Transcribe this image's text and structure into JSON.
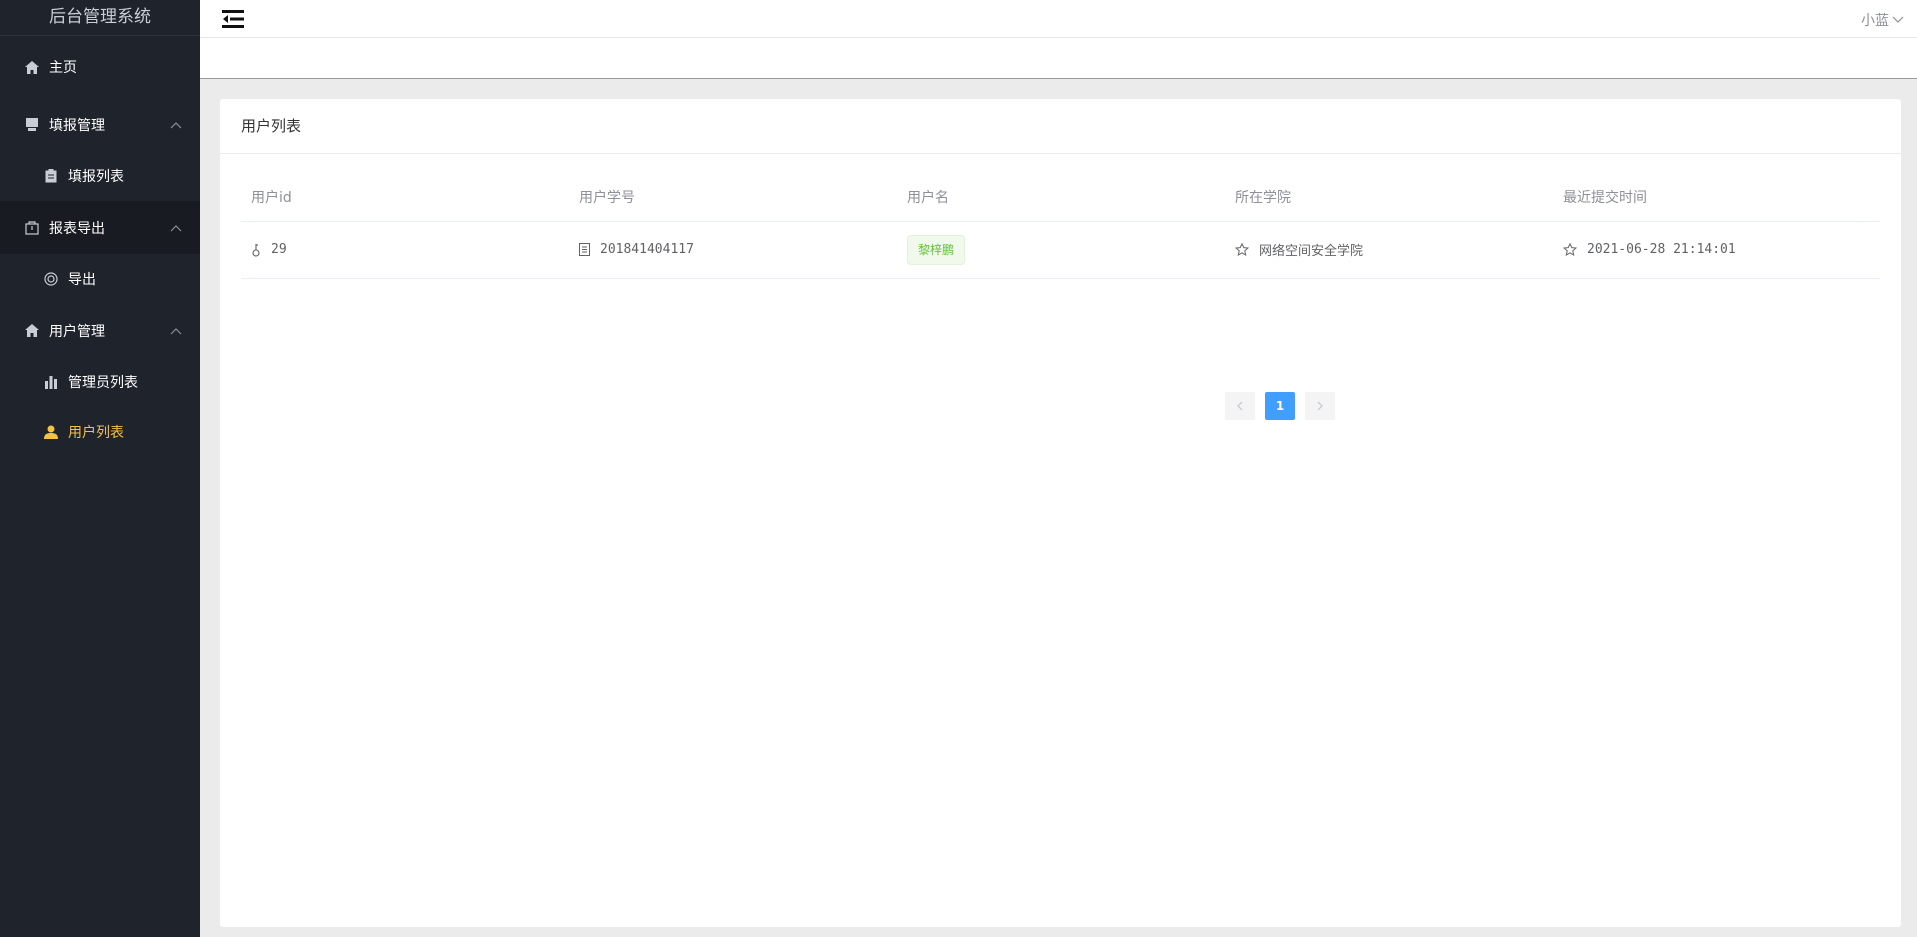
{
  "sidebar": {
    "brand": "后台管理系统",
    "items": [
      {
        "label": "主页"
      },
      {
        "label": "填报管理"
      },
      {
        "label": "填报列表"
      },
      {
        "label": "报表导出"
      },
      {
        "label": "导出"
      },
      {
        "label": "用户管理"
      },
      {
        "label": "管理员列表"
      },
      {
        "label": "用户列表"
      }
    ]
  },
  "topbar": {
    "user_name": "小蓝"
  },
  "card": {
    "title": "用户列表"
  },
  "table": {
    "headers": [
      "用户id",
      "用户学号",
      "用户名",
      "所在学院",
      "最近提交时间"
    ],
    "rows": [
      {
        "id": "29",
        "student_no": "201841404117",
        "username": "黎梓鹏",
        "college": "网络空间安全学院",
        "last_submit": "2021-06-28 21:14:01"
      }
    ]
  },
  "pagination": {
    "current_page": "1"
  },
  "colors": {
    "sidebar_bg": "#1f232b",
    "active_item": "#f5c140",
    "primary": "#409eff",
    "tag_green": "#67c23a"
  }
}
